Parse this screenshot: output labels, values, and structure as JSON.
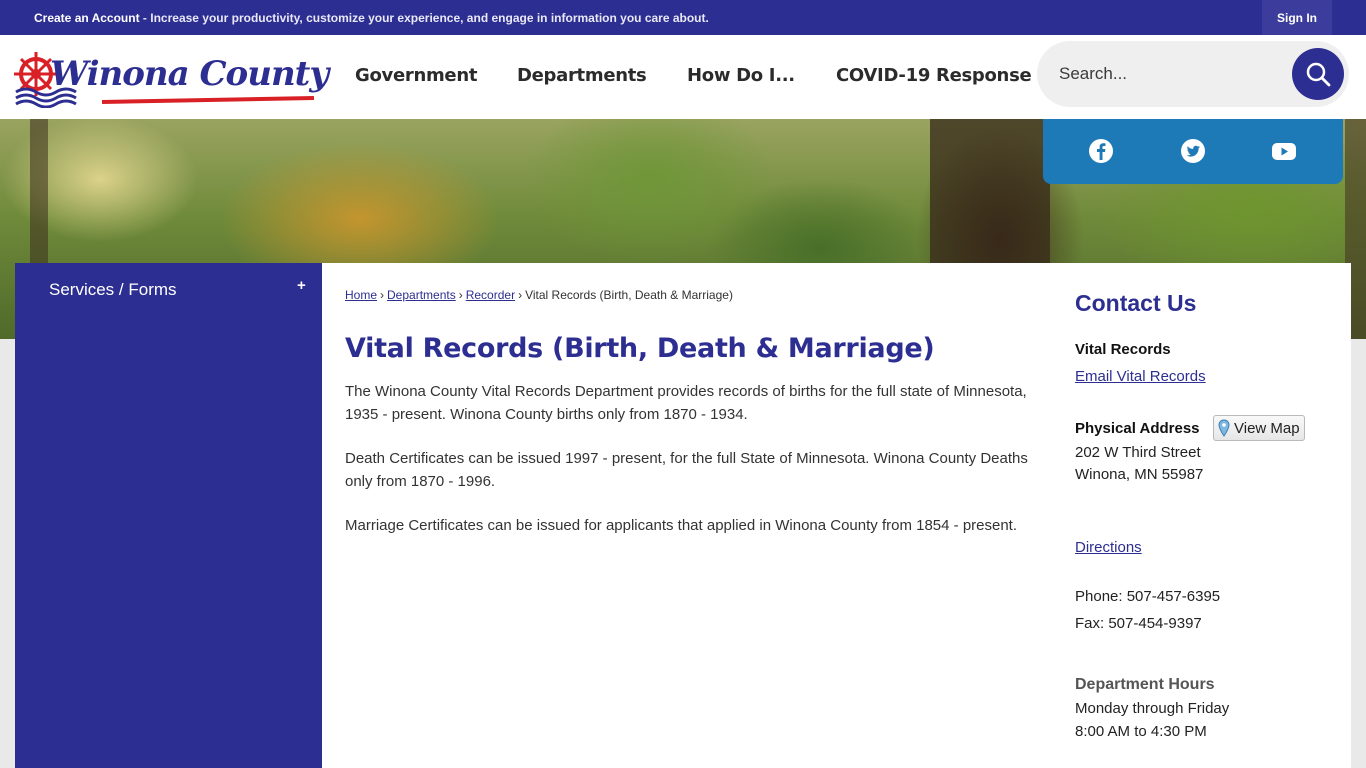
{
  "topbar": {
    "promo_lead": "Create an Account",
    "promo_rest": " - Increase your productivity, customize your experience, and engage in information you care about.",
    "signin": "Sign In"
  },
  "header": {
    "logo_text": "Winona County",
    "nav": [
      "Government",
      "Departments",
      "How Do I...",
      "COVID-19 Response"
    ],
    "search_placeholder": "Search...",
    "search_icon": "search-icon"
  },
  "social": {
    "icons": [
      "facebook-icon",
      "twitter-icon",
      "youtube-icon"
    ],
    "color": "#1e7ab7"
  },
  "sidenav": {
    "item": "Services / Forms",
    "toggle": "+"
  },
  "breadcrumb": {
    "items": [
      "Home",
      "Departments",
      "Recorder"
    ],
    "separator": "›",
    "current": "Vital Records (Birth, Death & Marriage)"
  },
  "page": {
    "title": "Vital Records (Birth, Death & Marriage)",
    "paragraphs": [
      "The Winona County Vital Records Department provides records of births for the full state of Minnesota,   1935 - present. Winona County births only from 1870 - 1934.",
      "Death Certificates can be issued 1997 - present, for the full State of Minnesota.  Winona County Deaths only from 1870 - 1996.",
      "Marriage Certificates can be issued for applicants that applied in Winona County from 1854 - present."
    ]
  },
  "contact": {
    "heading": "Contact Us",
    "dept": "Vital Records",
    "email_link": "Email Vital Records",
    "address_label": "Physical Address",
    "view_map": "View Map",
    "address_line1": "202 W Third Street",
    "address_line2": "Winona, MN 55987",
    "directions": "Directions",
    "phone": "Phone: 507-457-6395",
    "fax": "Fax: 507-454-9397",
    "hours_label": "Department Hours",
    "hours_days": "Monday through Friday",
    "hours_time": "8:00 AM to 4:30 PM"
  },
  "colors": {
    "brand": "#2d2e91",
    "accent_red": "#d92027"
  }
}
